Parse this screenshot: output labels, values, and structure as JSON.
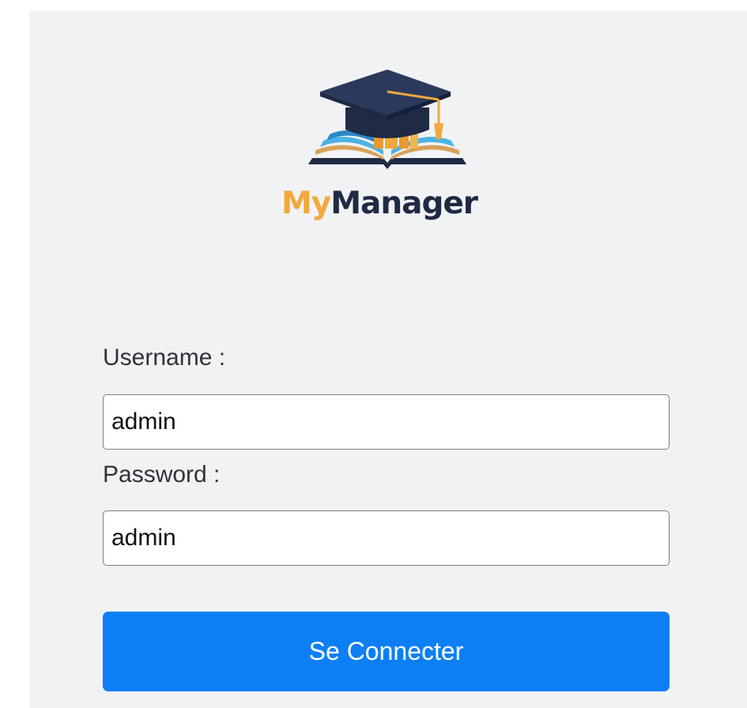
{
  "brand": {
    "name_prefix": "My",
    "name_suffix": "Manager"
  },
  "form": {
    "username_label": "Username :",
    "username_value": "admin",
    "password_label": "Password :",
    "password_value": "admin",
    "submit_label": "Se Connecter"
  },
  "colors": {
    "accent": "#0d7ff5",
    "brand_orange": "#f2a93b",
    "brand_navy": "#1f2a44",
    "panel_background": "#f1f2f4"
  },
  "icons": [
    "graduation-cap-book-logo-icon"
  ]
}
